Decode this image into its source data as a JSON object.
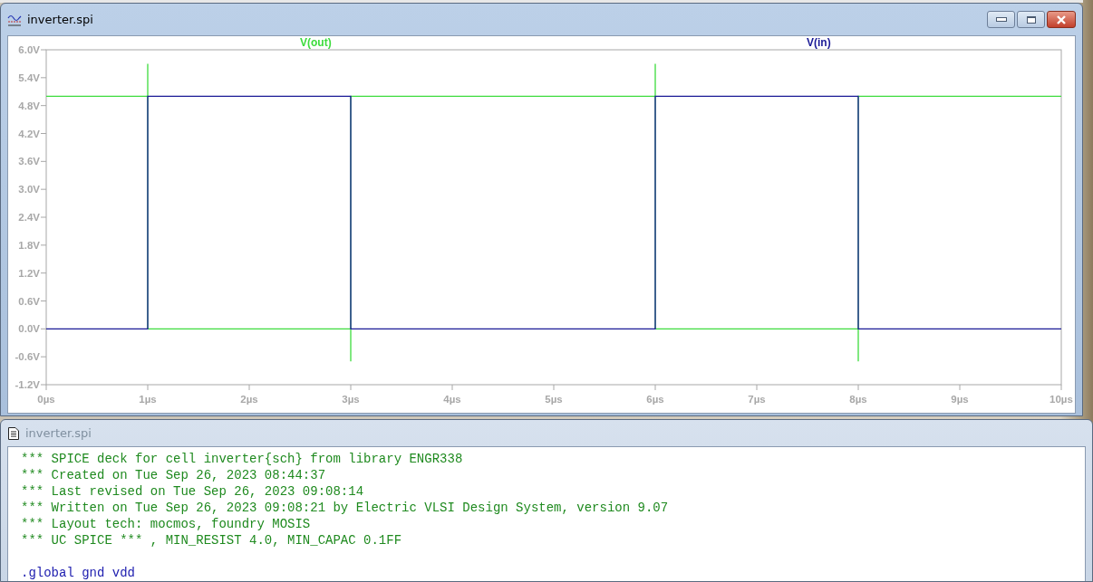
{
  "plot_window": {
    "title": "inverter.spi",
    "active": true,
    "chart_data": {
      "type": "line",
      "x": [
        0,
        1,
        1,
        1,
        3,
        3,
        3,
        6,
        6,
        6,
        8,
        8,
        8,
        10
      ],
      "series": [
        {
          "name": "V(out)",
          "color": "#3ddc3d",
          "values": [
            5,
            5,
            5.7,
            0,
            0,
            -0.7,
            5,
            5,
            5.7,
            0,
            0,
            -0.7,
            5,
            5
          ]
        },
        {
          "name": "V(in)",
          "color": "#1a1a96",
          "values": [
            0,
            0,
            0,
            5,
            5,
            5,
            0,
            0,
            0,
            5,
            5,
            5,
            0,
            0
          ]
        }
      ],
      "xlim": [
        0,
        10
      ],
      "ylim": [
        -1.2,
        6
      ],
      "xticks": [
        {
          "value": 0,
          "label": "0µs"
        },
        {
          "value": 1,
          "label": "1µs"
        },
        {
          "value": 2,
          "label": "2µs"
        },
        {
          "value": 3,
          "label": "3µs"
        },
        {
          "value": 4,
          "label": "4µs"
        },
        {
          "value": 5,
          "label": "5µs"
        },
        {
          "value": 6,
          "label": "6µs"
        },
        {
          "value": 7,
          "label": "7µs"
        },
        {
          "value": 8,
          "label": "8µs"
        },
        {
          "value": 9,
          "label": "9µs"
        },
        {
          "value": 10,
          "label": "10µs"
        }
      ],
      "yticks": [
        {
          "value": 6,
          "label": "6.0V"
        },
        {
          "value": 5.4,
          "label": "5.4V"
        },
        {
          "value": 4.8,
          "label": "4.8V"
        },
        {
          "value": 4.2,
          "label": "4.2V"
        },
        {
          "value": 3.6,
          "label": "3.6V"
        },
        {
          "value": 3,
          "label": "3.0V"
        },
        {
          "value": 2.4,
          "label": "2.4V"
        },
        {
          "value": 1.8,
          "label": "1.8V"
        },
        {
          "value": 1.2,
          "label": "1.2V"
        },
        {
          "value": 0.6,
          "label": "0.6V"
        },
        {
          "value": 0,
          "label": "0.0V"
        },
        {
          "value": -0.6,
          "label": "-0.6V"
        },
        {
          "value": -1.2,
          "label": "-1.2V"
        }
      ]
    }
  },
  "netlist_window": {
    "title": "inverter.spi",
    "active": false,
    "lines": [
      {
        "kind": "comment",
        "text": "*** SPICE deck for cell inverter{sch} from library ENGR338"
      },
      {
        "kind": "comment",
        "text": "*** Created on Tue Sep 26, 2023 08:44:37"
      },
      {
        "kind": "comment",
        "text": "*** Last revised on Tue Sep 26, 2023 09:08:14"
      },
      {
        "kind": "comment",
        "text": "*** Written on Tue Sep 26, 2023 09:08:21 by Electric VLSI Design System, version 9.07"
      },
      {
        "kind": "comment",
        "text": "*** Layout tech: mocmos, foundry MOSIS"
      },
      {
        "kind": "comment",
        "text": "*** UC SPICE *** , MIN_RESIST 4.0, MIN_CAPAC 0.1FF"
      },
      {
        "kind": "command",
        "text": ".global gnd vdd"
      }
    ]
  }
}
